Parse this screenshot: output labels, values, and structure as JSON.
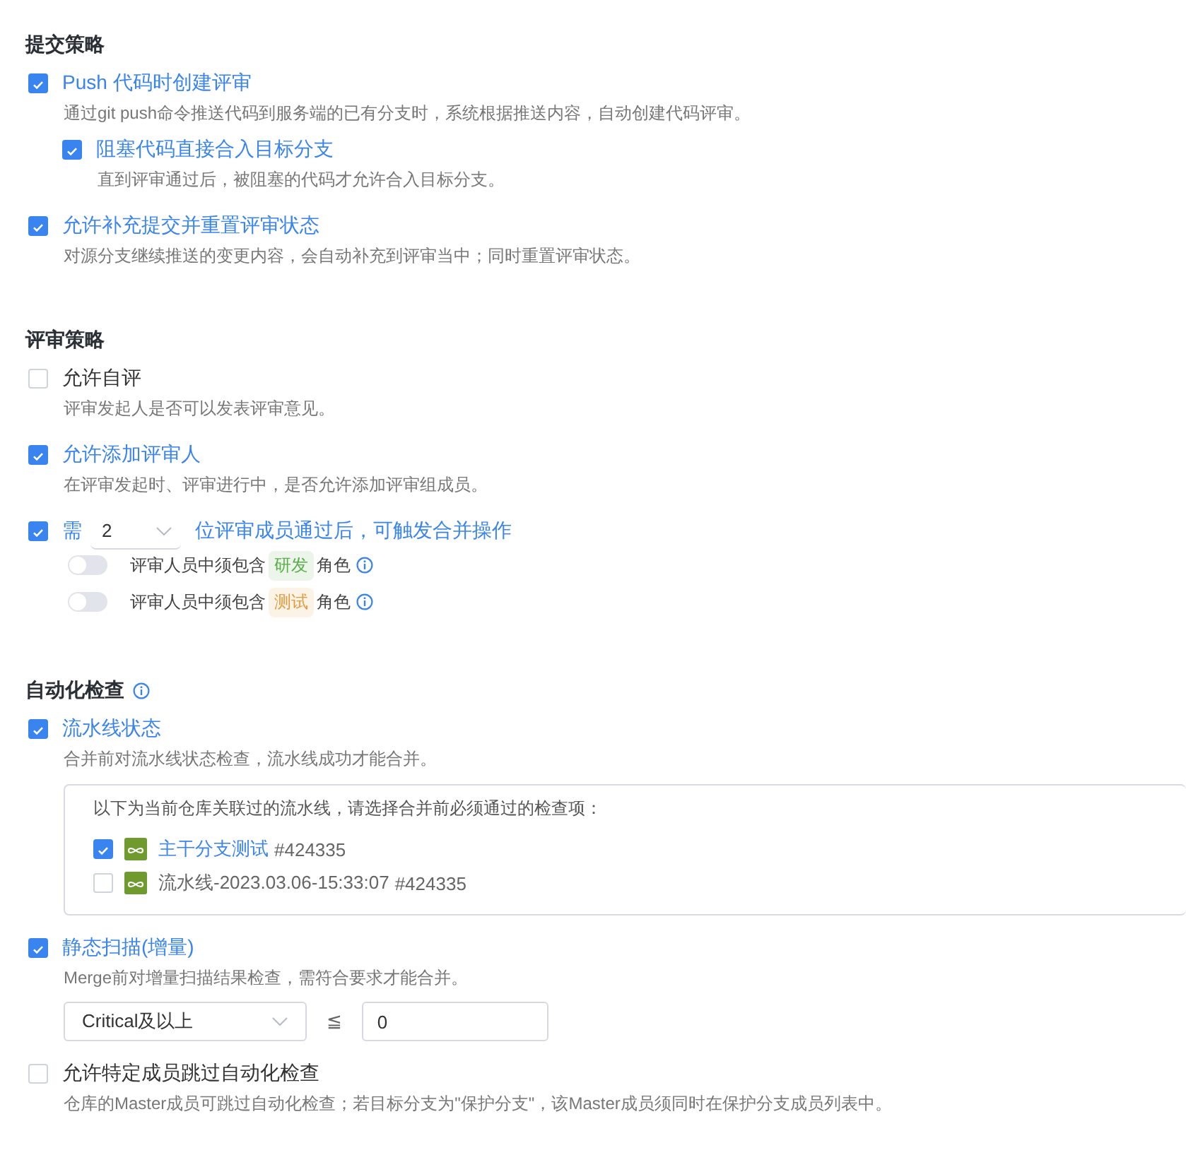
{
  "sections": [
    {
      "title": "提交策略",
      "info": false,
      "options": [
        {
          "kind": "checkbox",
          "label": "Push 代码时创建评审",
          "checked": true,
          "description": "通过git push命令推送代码到服务端的已有分支时，系统根据推送内容，自动创建代码评审。",
          "children": [
            {
              "label": "阻塞代码直接合入目标分支",
              "checked": true,
              "description": "直到评审通过后，被阻塞的代码才允许合入目标分支。"
            }
          ]
        },
        {
          "kind": "checkbox",
          "label": "允许补充提交并重置评审状态",
          "checked": true,
          "description": "对源分支继续推送的变更内容，会自动补充到评审当中；同时重置评审状态。"
        }
      ]
    },
    {
      "title": "评审策略",
      "info": false,
      "options": [
        {
          "kind": "checkbox",
          "label": "允许自评",
          "checked": false,
          "description": "评审发起人是否可以发表评审意见。"
        },
        {
          "kind": "checkbox",
          "label": "允许添加评审人",
          "checked": true,
          "description": "在评审发起时、评审进行中，是否允许添加评审组成员。"
        },
        {
          "kind": "threshold",
          "checked": true,
          "prefix": "需",
          "value": "2",
          "suffix": "位评审成员通过后，可触发合并操作",
          "toggles": [
            {
              "on": false,
              "before": "评审人员中须包含",
              "tag": "研发",
              "color": "#5aae4a",
              "after": "角色"
            },
            {
              "on": false,
              "before": "评审人员中须包含",
              "tag": "测试",
              "color": "#e59a3c",
              "after": "角色"
            }
          ]
        }
      ]
    },
    {
      "title": "自动化检查",
      "info": true,
      "options": [
        {
          "kind": "pipelines",
          "label": "流水线状态",
          "checked": true,
          "description": "合并前对流水线状态检查，流水线成功才能合并。",
          "intro": "以下为当前仓库关联过的流水线，请选择合并前必须通过的检查项：",
          "pipelines": [
            {
              "name": "主干分支测试",
              "id": "#424335",
              "checked": true
            },
            {
              "name": "流水线-2023.03.06-15:33:07",
              "id": "#424335",
              "checked": false
            }
          ]
        },
        {
          "kind": "scan",
          "label": "静态扫描(增量)",
          "checked": true,
          "description": "Merge前对增量扫描结果检查，需符合要求才能合并。",
          "level": "Critical及以上",
          "operator": "≦",
          "value": "0"
        },
        {
          "kind": "checkbox",
          "label": "允许特定成员跳过自动化检查",
          "checked": false,
          "description": "仓库的Master成员可跳过自动化检查；若目标分支为\"保护分支\"，该Master成员须同时在保护分支成员列表中。"
        }
      ]
    }
  ]
}
